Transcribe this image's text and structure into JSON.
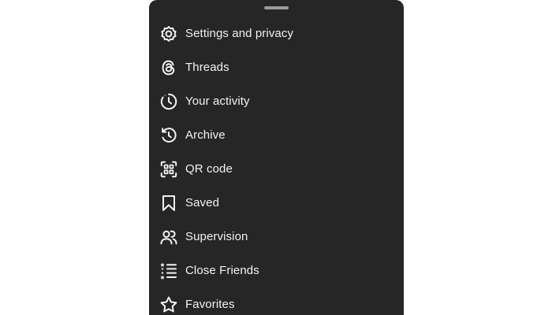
{
  "colors": {
    "sheet_background": "#262626",
    "text": "#f2f2f2",
    "handle": "#9a9a9a"
  },
  "menu": {
    "items": [
      {
        "label": "Settings and privacy",
        "icon": "settings-gear-icon"
      },
      {
        "label": "Threads",
        "icon": "threads-icon"
      },
      {
        "label": "Your activity",
        "icon": "activity-clock-icon"
      },
      {
        "label": "Archive",
        "icon": "archive-history-icon"
      },
      {
        "label": "QR code",
        "icon": "qr-code-icon"
      },
      {
        "label": "Saved",
        "icon": "bookmark-icon"
      },
      {
        "label": "Supervision",
        "icon": "supervision-people-icon"
      },
      {
        "label": "Close Friends",
        "icon": "close-friends-list-icon"
      },
      {
        "label": "Favorites",
        "icon": "star-icon"
      }
    ]
  }
}
